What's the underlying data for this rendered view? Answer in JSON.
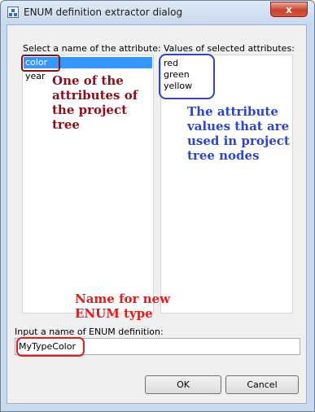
{
  "window": {
    "title": "ENUM definition extractor dialog",
    "close_glyph": "x"
  },
  "attributes_panel": {
    "label": "Select a name of the attribute:",
    "items": [
      "color",
      "year"
    ],
    "selected_index": 0
  },
  "values_panel": {
    "label": "Values of selected attributes:",
    "items": [
      "red",
      "green",
      "yellow"
    ]
  },
  "enum_input": {
    "label": "Input a name of ENUM definition:",
    "value": "MyTypeColor"
  },
  "buttons": {
    "ok": "OK",
    "cancel": "Cancel"
  },
  "annotations": {
    "attribute_note": "One of the attributes of the project tree",
    "values_note": "The attribute values that are used in project tree nodes",
    "name_note": "Name for new ENUM type",
    "colors": {
      "attribute": "#8b0f1a",
      "values": "#2e46c8",
      "name": "#e21b1b"
    }
  }
}
